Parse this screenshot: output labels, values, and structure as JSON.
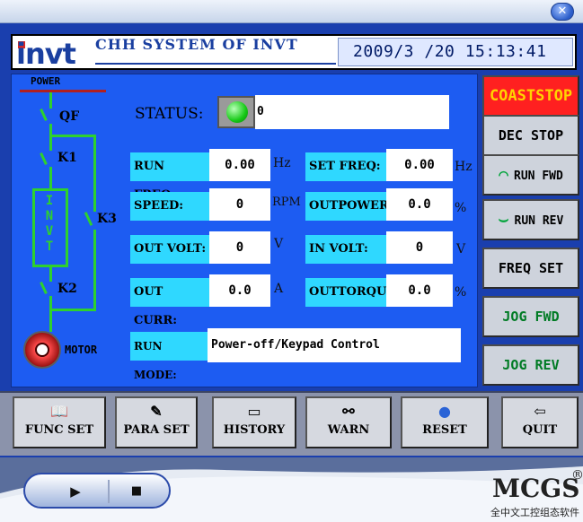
{
  "window": {
    "close_glyph": "✕"
  },
  "header": {
    "logo": "invt",
    "title": "CHH SYSTEM OF INVT",
    "datetime": "2009/3 /20 15:13:41"
  },
  "diagram": {
    "power_label": "POWER",
    "qf": "QF",
    "k1": "K1",
    "k2": "K2",
    "k3": "K3",
    "invt_vertical": "INVT",
    "motor_label": "MOTOR",
    "wire_color": "#2ed12e"
  },
  "status": {
    "label": "STATUS:",
    "value": "0",
    "led_state": "green"
  },
  "fields": {
    "run_freq": {
      "label": "RUN FREQ:",
      "value": "0.00",
      "unit": "Hz"
    },
    "set_freq": {
      "label": "SET FREQ:",
      "value": "0.00",
      "unit": "Hz"
    },
    "speed": {
      "label": "SPEED:",
      "value": "0",
      "unit": "RPM"
    },
    "outpower": {
      "label": "OUTPOWER:",
      "value": "0.0",
      "unit": "%"
    },
    "out_volt": {
      "label": "OUT VOLT:",
      "value": "0",
      "unit": "V"
    },
    "in_volt": {
      "label": "IN VOLT:",
      "value": "0",
      "unit": "V"
    },
    "out_curr": {
      "label": "OUT CURR:",
      "value": "0.0",
      "unit": "A"
    },
    "outtorqu": {
      "label": "OUTTORQU:",
      "value": "0.0",
      "unit": "%"
    }
  },
  "run_mode": {
    "label": "RUN MODE:",
    "value": "Power-off/Keypad Control"
  },
  "right_buttons": {
    "coaststop": "COASTSTOP",
    "dec_stop": "DEC STOP",
    "run_fwd": "RUN FWD",
    "run_rev": "RUN REV",
    "freq_set": "FREQ SET",
    "jog_fwd": "JOG FWD",
    "jog_rev": "JOG REV"
  },
  "bottom_buttons": {
    "func_set": "FUNC SET",
    "para_set": "PARA SET",
    "history": "HISTORY",
    "warn": "WARN",
    "reset": "RESET",
    "quit": "QUIT"
  },
  "footer": {
    "brand": "MCGS",
    "registered": "®",
    "subtitle": "全中文工控组态软件",
    "play_glyph": "▶",
    "stop_glyph": "■"
  },
  "colors": {
    "panel_blue": "#1d5cf2",
    "field_label_cyan": "#2fd8ff",
    "coaststop_red": "#ff2020",
    "coaststop_text": "#ffd400",
    "jog_text_green": "#007b24"
  }
}
